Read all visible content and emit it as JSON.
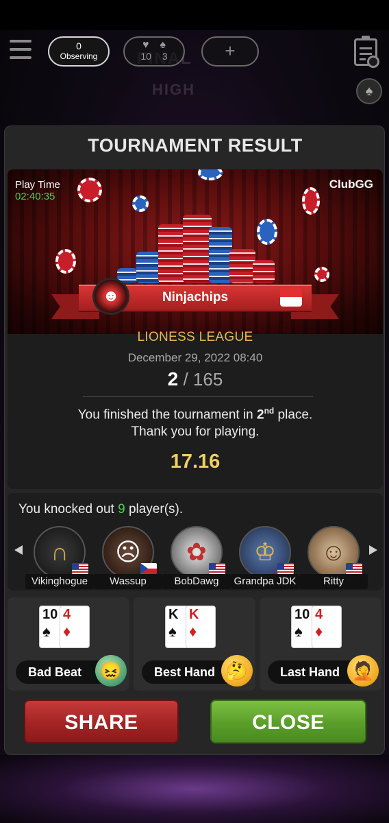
{
  "topbar": {
    "observing_count": "0",
    "observing_label": "Observing",
    "hearts_value": "10",
    "spades_value": "3",
    "plus_label": "+",
    "background_text_1": "FINAL",
    "background_text_2": "HIGH"
  },
  "modal": {
    "title": "TOURNAMENT RESULT",
    "play_time_label": "Play Time",
    "play_time_value": "02:40:35",
    "brand": "ClubGG",
    "player_name": "Ninjachips",
    "league": "LIONESS LEAGUE",
    "date": "December 29, 2022 08:40",
    "rank_place": "2",
    "rank_total": " / 165",
    "message_prefix": "You finished the tournament in ",
    "message_place": "2",
    "message_suffix_sup": "nd",
    "message_end": " place.",
    "message_line2": "Thank you for playing.",
    "prize": "17.16"
  },
  "knockouts": {
    "prefix": "You knocked out ",
    "count": "9",
    "suffix": " player(s).",
    "players": [
      {
        "name": "Vikinghogue",
        "flag": "us"
      },
      {
        "name": "Wassup",
        "flag": "cz"
      },
      {
        "name": "BobDawg",
        "flag": "us"
      },
      {
        "name": "Grandpa JDK",
        "flag": "us"
      },
      {
        "name": "Ritty",
        "flag": "us"
      }
    ]
  },
  "hands": [
    {
      "label": "Bad Beat",
      "card1_rank": "10",
      "card1_suit": "♠",
      "card2_rank": "4",
      "card2_suit": "♦",
      "emoji": "green-sick-face"
    },
    {
      "label": "Best Hand",
      "card1_rank": "K",
      "card1_suit": "♠",
      "card2_rank": "K",
      "card2_suit": "♦",
      "emoji": "thinking-face"
    },
    {
      "label": "Last Hand",
      "card1_rank": "10",
      "card1_suit": "♠",
      "card2_rank": "4",
      "card2_suit": "♦",
      "emoji": "facepalm-face"
    }
  ],
  "buttons": {
    "share": "SHARE",
    "close": "CLOSE"
  },
  "colors": {
    "accent_gold": "#e7b84a",
    "prize_gold": "#f0d060",
    "green": "#4fd04f",
    "share_red": "#a32424",
    "close_green": "#5a9e2a"
  }
}
